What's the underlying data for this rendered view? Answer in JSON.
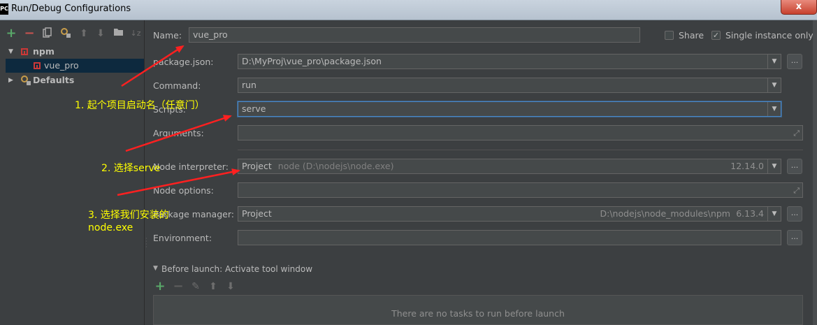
{
  "window": {
    "app_icon_text": "PC",
    "title": "Run/Debug Configurations",
    "close_label": "x"
  },
  "left_toolbar": {
    "icons": [
      "add-icon",
      "remove-icon",
      "copy-icon",
      "settings-icon",
      "move-up-icon",
      "move-down-icon",
      "folder-icon",
      "sort-icon"
    ]
  },
  "tree": {
    "group": {
      "label": "npm",
      "expanded": true
    },
    "item": {
      "label": "vue_pro",
      "selected": true
    },
    "defaults": {
      "label": "Defaults",
      "expanded": false
    }
  },
  "form": {
    "name_label": "Name:",
    "name_value": "vue_pro",
    "share_label": "Share",
    "share_checked": false,
    "single_instance_label": "Single instance only",
    "single_instance_checked": true,
    "package_json_label": "package.json:",
    "package_json_value": "D:\\MyProj\\vue_pro\\package.json",
    "command_label": "Command:",
    "command_value": "run",
    "scripts_label": "Scripts:",
    "scripts_value": "serve",
    "arguments_label": "Arguments:",
    "arguments_value": "",
    "node_interpreter_label": "Node interpreter:",
    "node_interpreter_value": "Project",
    "node_interpreter_path": "node (D:\\nodejs\\node.exe)",
    "node_interpreter_version": "12.14.0",
    "node_options_label": "Node options:",
    "node_options_value": "",
    "package_manager_label": "Package manager:",
    "package_manager_value": "Project",
    "package_manager_path": "D:\\nodejs\\node_modules\\npm",
    "package_manager_version": "6.13.4",
    "environment_label": "Environment:",
    "environment_value": "",
    "dots_label": "..."
  },
  "before_launch": {
    "header": "Before launch: Activate tool window",
    "empty_text": "There are no tasks to run before launch",
    "toolbar_icons": [
      "add-icon",
      "remove-icon",
      "edit-icon",
      "move-up-icon",
      "move-down-icon"
    ]
  },
  "annotations": {
    "note1": "1. 起个项目启动名（任意门）",
    "note2": "2. 选择serve",
    "note3_line1": "3. 选择我们安装的",
    "note3_line2": "node.exe",
    "color": "#ffff00",
    "arrow_color": "#ff2020"
  },
  "colors": {
    "background": "#3c3f41",
    "field": "#45494a",
    "selection": "#0d293e",
    "add_green": "#59a869",
    "remove_red": "#c75450"
  }
}
